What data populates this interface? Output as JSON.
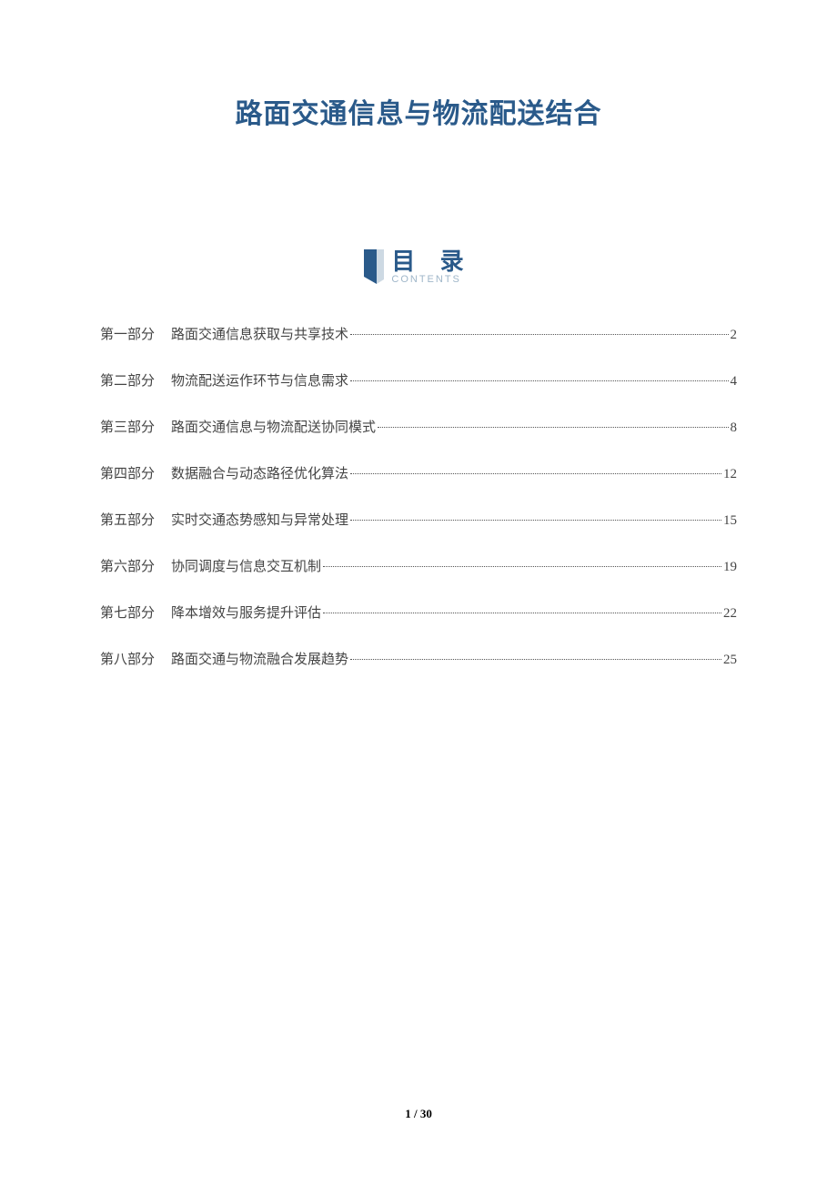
{
  "title": "路面交通信息与物流配送结合",
  "toc_heading": {
    "cn": "目 录",
    "en": "CONTENTS"
  },
  "toc": [
    {
      "part": "第一部分",
      "title": "路面交通信息获取与共享技术",
      "page": "2"
    },
    {
      "part": "第二部分",
      "title": "物流配送运作环节与信息需求",
      "page": "4"
    },
    {
      "part": "第三部分",
      "title": "路面交通信息与物流配送协同模式",
      "page": "8"
    },
    {
      "part": "第四部分",
      "title": "数据融合与动态路径优化算法",
      "page": "12"
    },
    {
      "part": "第五部分",
      "title": "实时交通态势感知与异常处理",
      "page": "15"
    },
    {
      "part": "第六部分",
      "title": "协同调度与信息交互机制",
      "page": "19"
    },
    {
      "part": "第七部分",
      "title": "降本增效与服务提升评估",
      "page": "22"
    },
    {
      "part": "第八部分",
      "title": "路面交通与物流融合发展趋势",
      "page": "25"
    }
  ],
  "footer": {
    "current": "1",
    "sep": " / ",
    "total": "30"
  }
}
